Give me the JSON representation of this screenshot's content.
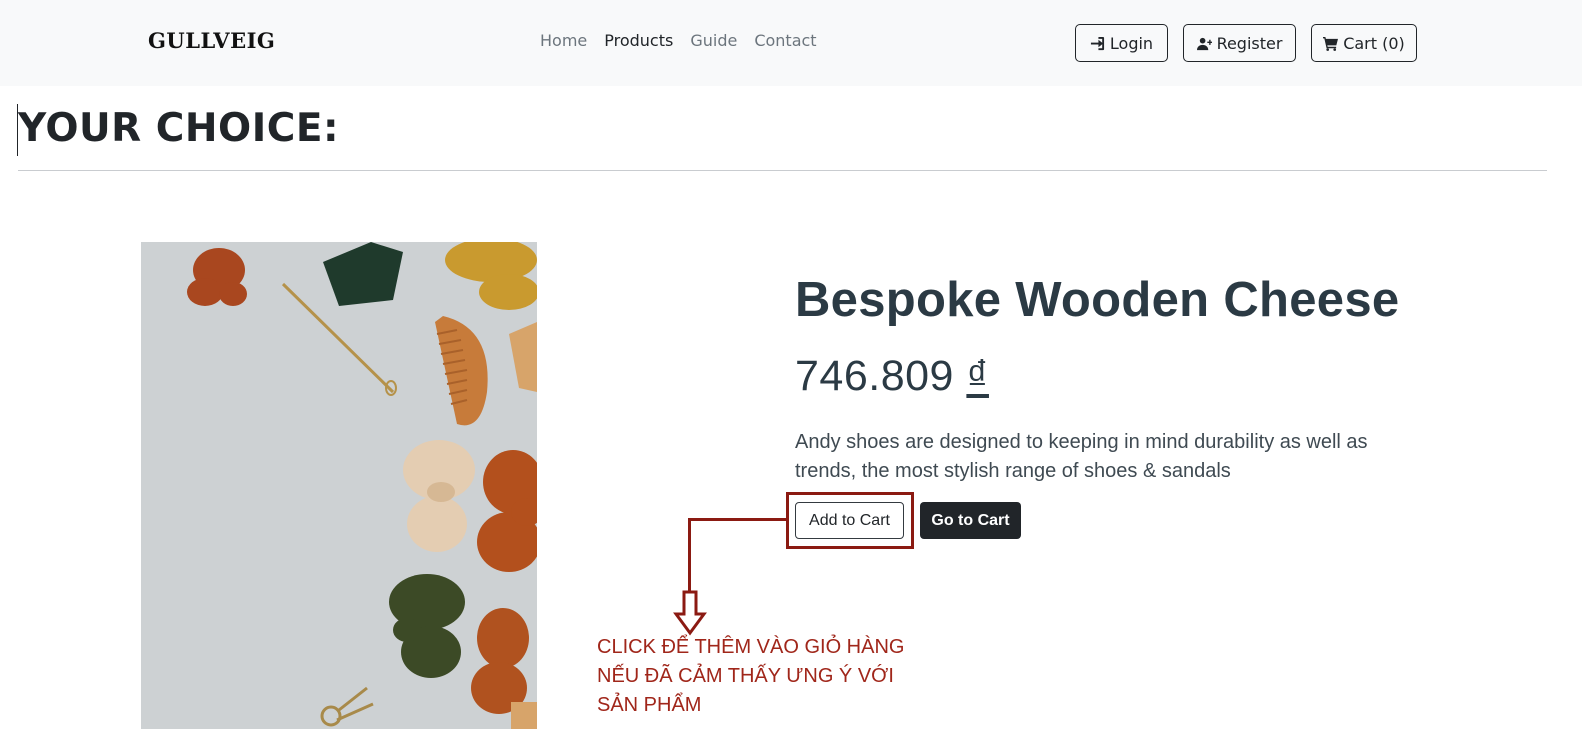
{
  "navbar": {
    "brand": "GULLVEIG",
    "links": [
      {
        "label": "Home",
        "active": false
      },
      {
        "label": "Products",
        "active": true
      },
      {
        "label": "Guide",
        "active": false
      },
      {
        "label": "Contact",
        "active": false
      }
    ],
    "login_label": "Login",
    "register_label": "Register",
    "cart_label": "Cart (0)",
    "login_icon": "sign-in-icon",
    "register_icon": "user-plus-icon",
    "cart_icon": "cart-icon"
  },
  "page": {
    "title": "YOUR CHOICE:"
  },
  "product": {
    "name": "Bespoke Wooden Cheese",
    "price_value": "746.809",
    "price_currency": "₫",
    "description": "Andy shoes are designed to keeping in mind durability as well as trends, the most stylish range of shoes & sandals",
    "add_to_cart_label": "Add to Cart",
    "go_to_cart_label": "Go to Cart"
  },
  "annotation": {
    "lines": [
      "CLICK ĐỂ THÊM VÀO GIỎ HÀNG",
      "NẾU ĐÃ CẢM THẤY ƯNG Ý VỚI",
      "SẢN PHẨM"
    ],
    "color": "#8b1a12"
  },
  "colors": {
    "navbar_bg": "#f8f9fa",
    "dark": "#212529",
    "muted_link": "#6c757d",
    "product_text": "#2b3a44"
  }
}
